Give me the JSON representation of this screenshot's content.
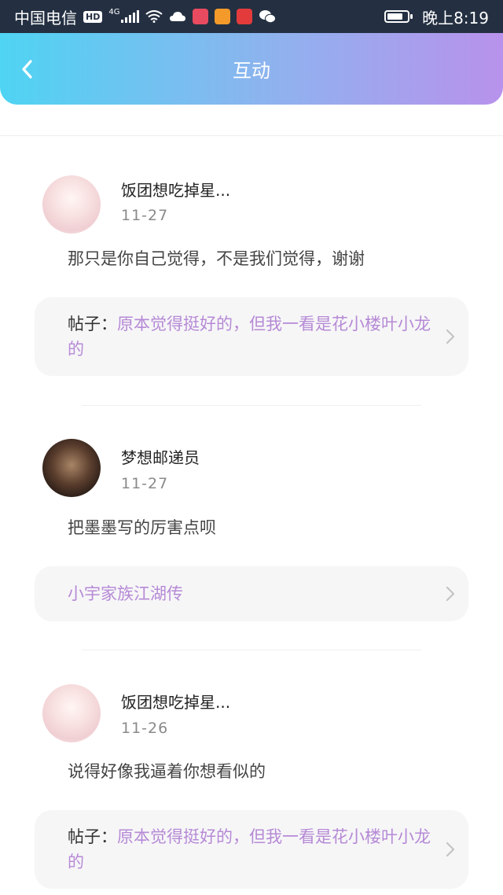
{
  "status_bar": {
    "carrier": "中国电信",
    "hd": "HD",
    "network": "4G",
    "time": "晚上8:19"
  },
  "header": {
    "title": "互动"
  },
  "items": [
    {
      "user": "饭团想吃掉星...",
      "date": "11-27",
      "comment": "那只是你自己觉得，不是我们觉得，谢谢",
      "post_prefix": "帖子：",
      "post_title": "原本觉得挺好的，但我一看是花小楼叶小龙的"
    },
    {
      "user": "梦想邮递员",
      "date": "11-27",
      "comment": "把墨墨写的厉害点呗",
      "post_prefix": "",
      "post_title": "小宇家族江湖传"
    },
    {
      "user": "饭团想吃掉星...",
      "date": "11-26",
      "comment": "说得好像我逼着你想看似的",
      "post_prefix": "帖子：",
      "post_title": "原本觉得挺好的，但我一看是花小楼叶小龙的"
    }
  ]
}
